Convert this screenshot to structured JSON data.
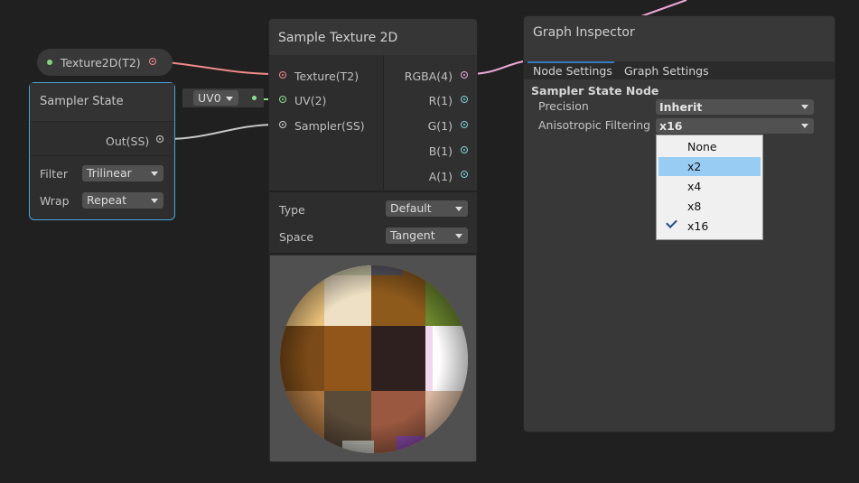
{
  "texture_property": {
    "label": "Texture2D(T2)"
  },
  "sampler_node": {
    "title": "Sampler State",
    "output": "Out(SS)",
    "filter_label": "Filter",
    "filter_value": "Trilinear",
    "wrap_label": "Wrap",
    "wrap_value": "Repeat"
  },
  "uv_chip": {
    "value": "UV0"
  },
  "sample_texture_node": {
    "title": "Sample Texture 2D",
    "inputs": [
      "Texture(T2)",
      "UV(2)",
      "Sampler(SS)"
    ],
    "outputs": [
      "RGBA(4)",
      "R(1)",
      "G(1)",
      "B(1)",
      "A(1)"
    ],
    "type_label": "Type",
    "type_value": "Default",
    "space_label": "Space",
    "space_value": "Tangent"
  },
  "inspector": {
    "title": "Graph Inspector",
    "tabs": [
      "Node Settings",
      "Graph Settings"
    ],
    "section": "Sampler State Node",
    "precision_label": "Precision",
    "precision_value": "Inherit",
    "aniso_label": "Anisotropic Filtering",
    "aniso_value": "x16",
    "dropdown_options": [
      "None",
      "x2",
      "x4",
      "x8",
      "x16"
    ],
    "highlighted_option": "x2",
    "checked_option": "x16"
  },
  "colors": {
    "texture_wire": "#f08a8a",
    "uv_wire": "#8ee08e",
    "sampler_wire": "#c8c8c8",
    "rgba_wire": "#f0a8d8",
    "output_port": "#7fd6d6",
    "selection_border": "#4aa3df"
  }
}
